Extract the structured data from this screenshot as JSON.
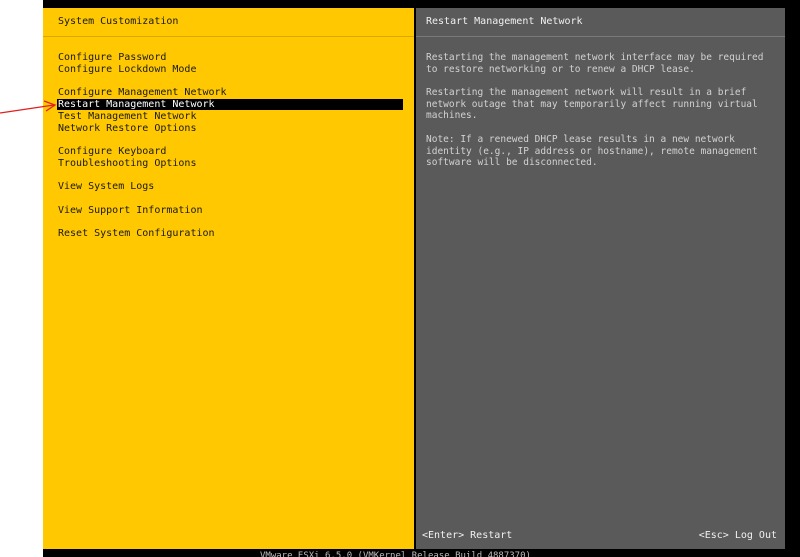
{
  "left_panel": {
    "title": "System Customization",
    "menu_items": [
      {
        "label": "Configure Password",
        "selected": false
      },
      {
        "label": "Configure Lockdown Mode",
        "selected": false
      },
      {
        "label": "Configure Management Network",
        "selected": false
      },
      {
        "label": "Restart Management Network",
        "selected": true
      },
      {
        "label": "Test Management Network",
        "selected": false
      },
      {
        "label": "Network Restore Options",
        "selected": false
      },
      {
        "label": "Configure Keyboard",
        "selected": false
      },
      {
        "label": "Troubleshooting Options",
        "selected": false
      },
      {
        "label": "View System Logs",
        "selected": false
      },
      {
        "label": "View Support Information",
        "selected": false
      },
      {
        "label": "Reset System Configuration",
        "selected": false
      }
    ]
  },
  "right_panel": {
    "title": "Restart Management Network",
    "paragraphs": [
      "Restarting the management network interface may be required\nto restore networking or to renew a DHCP lease.",
      "Restarting the management network will result in a brief\nnetwork outage that may temporarily affect running virtual\nmachines.",
      "Note: If a renewed DHCP lease results in a new network\nidentity (e.g., IP address or hostname), remote management\nsoftware will be disconnected."
    ],
    "footer_enter": "<Enter> Restart",
    "footer_esc": "<Esc> Log Out"
  },
  "bottom_strip_text": "VMware ESXi 6.5.0 (VMKernel Release Build 4887370)",
  "colors": {
    "left_panel_bg": "#ffc800",
    "right_panel_bg": "#5a5a5a",
    "selection_bg": "#000000",
    "annotation_arrow": "#e02020"
  },
  "icons": {
    "annotation": "red-arrow-icon"
  }
}
